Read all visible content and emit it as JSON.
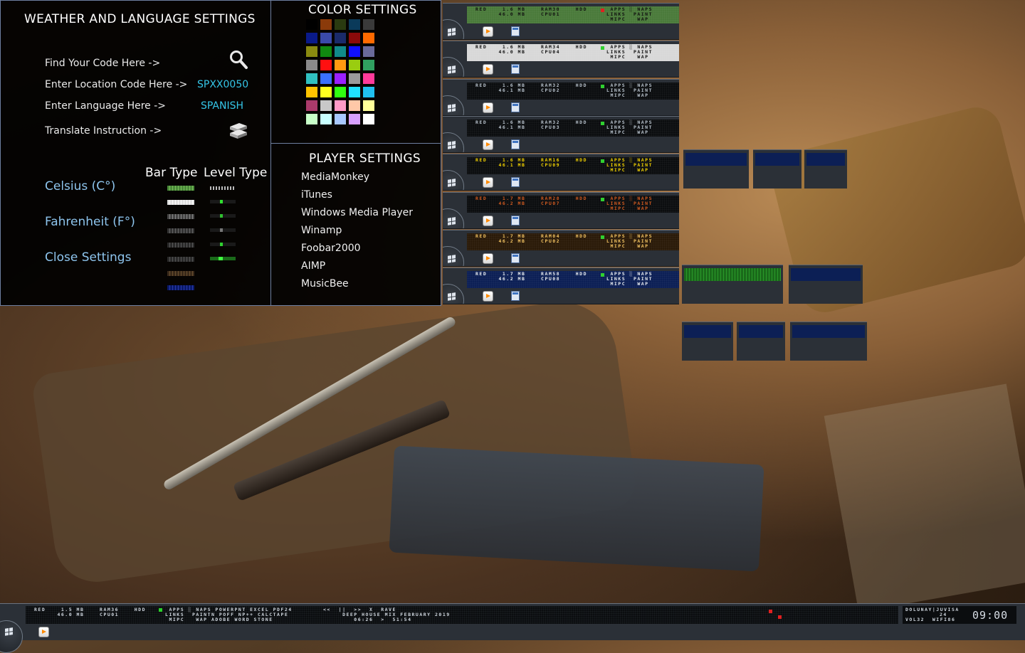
{
  "weather": {
    "title": "WEATHER AND LANGUAGE SETTINGS",
    "find_code": "Find Your Code Here ->",
    "location_label": "Enter Location Code Here ->",
    "location_value": "SPXX0050",
    "language_label": "Enter Language Here ->",
    "language_value": "SPANISH",
    "translate": "Translate Instruction ->",
    "bar_type": "Bar Type",
    "level_type": "Level Type",
    "celsius": "Celsius (C°)",
    "fahrenheit": "Fahrenheit (F°)",
    "close": "Close Settings"
  },
  "colors": {
    "title": "COLOR SETTINGS",
    "swatches": [
      "#000000",
      "#8a3a0a",
      "#2a3a10",
      "#0a3a5a",
      "#3a3a3a",
      "#0a1a8a",
      "#3a4aaa",
      "#1a2a6a",
      "#8a0a0a",
      "#ff6a00",
      "#8a8a10",
      "#108a10",
      "#108a8a",
      "#1010ff",
      "#6a6a9a",
      "#8a8a8a",
      "#ff1010",
      "#ff9a10",
      "#9acd10",
      "#30a060",
      "#30c0c0",
      "#3a70ff",
      "#9a20ff",
      "#9a9a9a",
      "#ff3a9a",
      "#ffc400",
      "#ffff20",
      "#30ff10",
      "#20e0ff",
      "#20c0f0",
      "#aa3a6a",
      "#c8c8c8",
      "#ff9ac8",
      "#ffc8a8",
      "#ffff9a",
      "#c8ffc8",
      "#c8ffff",
      "#a8c8ff",
      "#d8a0ff",
      "#ffffff"
    ]
  },
  "player": {
    "title": "PLAYER SETTINGS",
    "items": [
      "MediaMonkey",
      "iTunes",
      "Windows Media Player",
      "Winamp",
      "Foobar2000",
      "AIMP",
      "MusicBee"
    ]
  },
  "previews": [
    {
      "color": "#111111",
      "bg": "#4a7a3a",
      "l1": "RED    1.6 MB    RAM30    HDD      APPS ░ NAPS",
      "l2": "      46.0 MB    CPU01            LINKS  PAINT",
      "l3": "                                   MIPC   WAP"
    },
    {
      "color": "#111111",
      "bg": "#d8d8d8",
      "l1": "RED    1.6 MB    RAM34    HDD      APPS ░ NAPS",
      "l2": "      46.0 MB    CPU04            LINKS  PAINT",
      "l3": "                                   MIPC   WAP"
    },
    {
      "color": "#b8c2cc",
      "bg": "#0b0d0f",
      "l1": "RED    1.6 MB    RAM32    HDD      APPS ░ NAPS",
      "l2": "      46.1 MB    CPU02            LINKS  PAINT",
      "l3": "                                   MIPC   WAP"
    },
    {
      "color": "#b8c2cc",
      "bg": "#0b0d0f",
      "l1": "RED    1.6 MB    RAM32    HDD      APPS ░ NAPS",
      "l2": "      46.1 MB    CPU03            LINKS  PAINT",
      "l3": "                                   MIPC   WAP"
    },
    {
      "color": "#f0d000",
      "bg": "#0b0d0f",
      "l1": "RED    1.6 MB    RAM16    HDD      APPS ░ NAPS",
      "l2": "      46.1 MB    CPU09            LINKS  PAINT",
      "l3": "                                   MIPC   WAP"
    },
    {
      "color": "#d05a20",
      "bg": "#0b0d0f",
      "l1": "RED    1.7 MB    RAM28    HDD      APPS ░ NAPS",
      "l2": "      46.2 MB    CPU07            LINKS  PAINT",
      "l3": "                                   MIPC   WAP"
    },
    {
      "color": "#f0c060",
      "bg": "#2a1a08",
      "l1": "RED    1.7 MB    RAM04    HDD      APPS ░ NAPS",
      "l2": "      46.2 MB    CPU02            LINKS  PAINT",
      "l3": "                                   MIPC   WAP"
    },
    {
      "color": "#e8ecf0",
      "bg": "#0c1f55",
      "l1": "RED    1.7 MB    RAM58    HDD      APPS ░ NAPS",
      "l2": "      46.2 MB    CPU08            LINKS  PAINT",
      "l3": "                                   MIPC   WAP"
    }
  ],
  "taskbar": {
    "l1": "RED    1.5 MB    RAM36    HDD      APPS ░ NAPS POWERPNT EXCEL PDF24        <<  ||  >>  X  RAVE",
    "l2": "      46.0 MB    CPU01            LINKS  PAINTN POFF NP++ CALCTAPE              DEEP HOUSE MIX FEBRUARY 2019",
    "l3": "                                   MIPC   WAP ADOBE WORD STONE                     06:26  >  51:54",
    "right1": "DOLUNAY|JUVISA",
    "right2": "24",
    "right3": "VOL32  WIFI86",
    "clock": "09:00"
  },
  "icons": {
    "search": "search-icon",
    "translate": "books-icon",
    "start": "windows-start-icon",
    "media": "media-player-icon",
    "calc": "calculator-icon"
  }
}
